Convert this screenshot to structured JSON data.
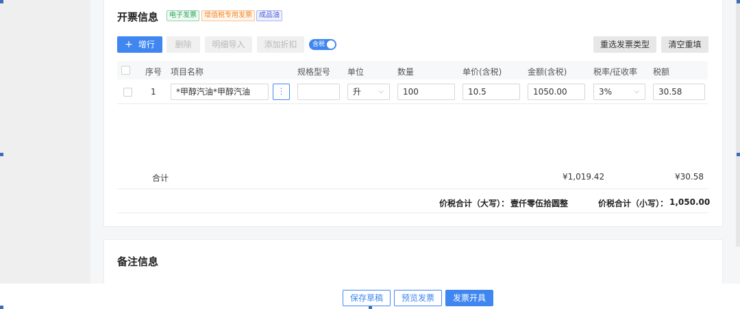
{
  "invoice": {
    "title": "开票信息",
    "tags": {
      "electronic": "电子发票",
      "vat_special": "增值税专用发票",
      "refined_oil": "成品油"
    }
  },
  "toolbar": {
    "add_row": "增行",
    "delete": "删除",
    "detail_import": "明细导入",
    "add_discount": "添加折扣",
    "tax_included_label": "含税",
    "tax_included": true,
    "reselect_type": "重选发票类型",
    "clear_refill": "清空重填"
  },
  "table": {
    "headers": {
      "index": "序号",
      "item_name": "项目名称",
      "spec": "规格型号",
      "unit": "单位",
      "quantity": "数量",
      "unit_price": "单价(含税)",
      "amount": "金额(含税)",
      "tax_rate": "税率/征收率",
      "tax": "税额"
    },
    "rows": [
      {
        "index": "1",
        "item_name": "*甲醇汽油*甲醇汽油",
        "spec": "",
        "unit": "升",
        "quantity": "100",
        "unit_price": "10.5",
        "amount": "1050.00",
        "tax_rate": "3%",
        "tax": "30.58"
      }
    ]
  },
  "totals": {
    "label": "合计",
    "amount": "¥1,019.42",
    "tax": "¥30.58",
    "total_upper_label": "价税合计（大写）：",
    "total_upper_value": "壹仟零伍拾圆整",
    "total_lower_label": "价税合计（小写）：",
    "total_lower_value": "1,050.00"
  },
  "remarks": {
    "title": "备注信息"
  },
  "footer": {
    "save_draft": "保存草稿",
    "preview": "预览发票",
    "issue": "发票开具"
  },
  "icons": {
    "add": "+",
    "more": "⋮",
    "dropdown": "⌵"
  },
  "colors": {
    "accent": "#3f86f0",
    "green_tag": "#2fa35b",
    "orange_tag": "#f08a2c",
    "blue_tag": "#4b5fd6"
  }
}
